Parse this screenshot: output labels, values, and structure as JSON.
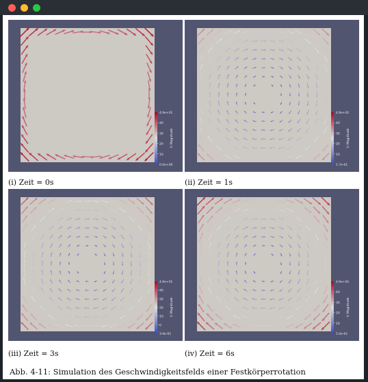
{
  "window": {
    "controls": [
      "close",
      "minimize",
      "maximize"
    ]
  },
  "panels": [
    {
      "caption": "(i) Zeit = 0s",
      "colorbar": {
        "top": "4.9e+01",
        "ticks": [
          "40",
          "30",
          "20",
          "10"
        ],
        "bottom": "0.0e+00",
        "title": "U Magnitude"
      },
      "t": 0
    },
    {
      "caption": "(ii) Zeit = 1s",
      "colorbar": {
        "top": "4.9e+01",
        "ticks": [
          "40",
          "30",
          "20",
          "10"
        ],
        "bottom": "1.7e-01",
        "title": "U Magnitude"
      },
      "t": 1
    },
    {
      "caption": "(iii) Zeit = 3s",
      "colorbar": {
        "top": "4.9e+01",
        "ticks": [
          "40",
          "30",
          "20",
          "10",
          "0"
        ],
        "bottom": "3.9e-01",
        "title": "U Magnitude"
      },
      "t": 3
    },
    {
      "caption": "(iv) Zeit = 6s",
      "colorbar": {
        "top": "4.9e+01",
        "ticks": [
          "40",
          "30",
          "20",
          "10"
        ],
        "bottom": "5.0e-01",
        "title": "U Magnitude"
      },
      "t": 6
    }
  ],
  "figure_caption": "Abb. 4-11: Simulation des Geschwindigkeitsfelds einer Festkörperrotation",
  "colors": {
    "background": "#525570",
    "domain": "#cdc9c3",
    "low": "#3b4cc0",
    "high": "#b40426"
  }
}
